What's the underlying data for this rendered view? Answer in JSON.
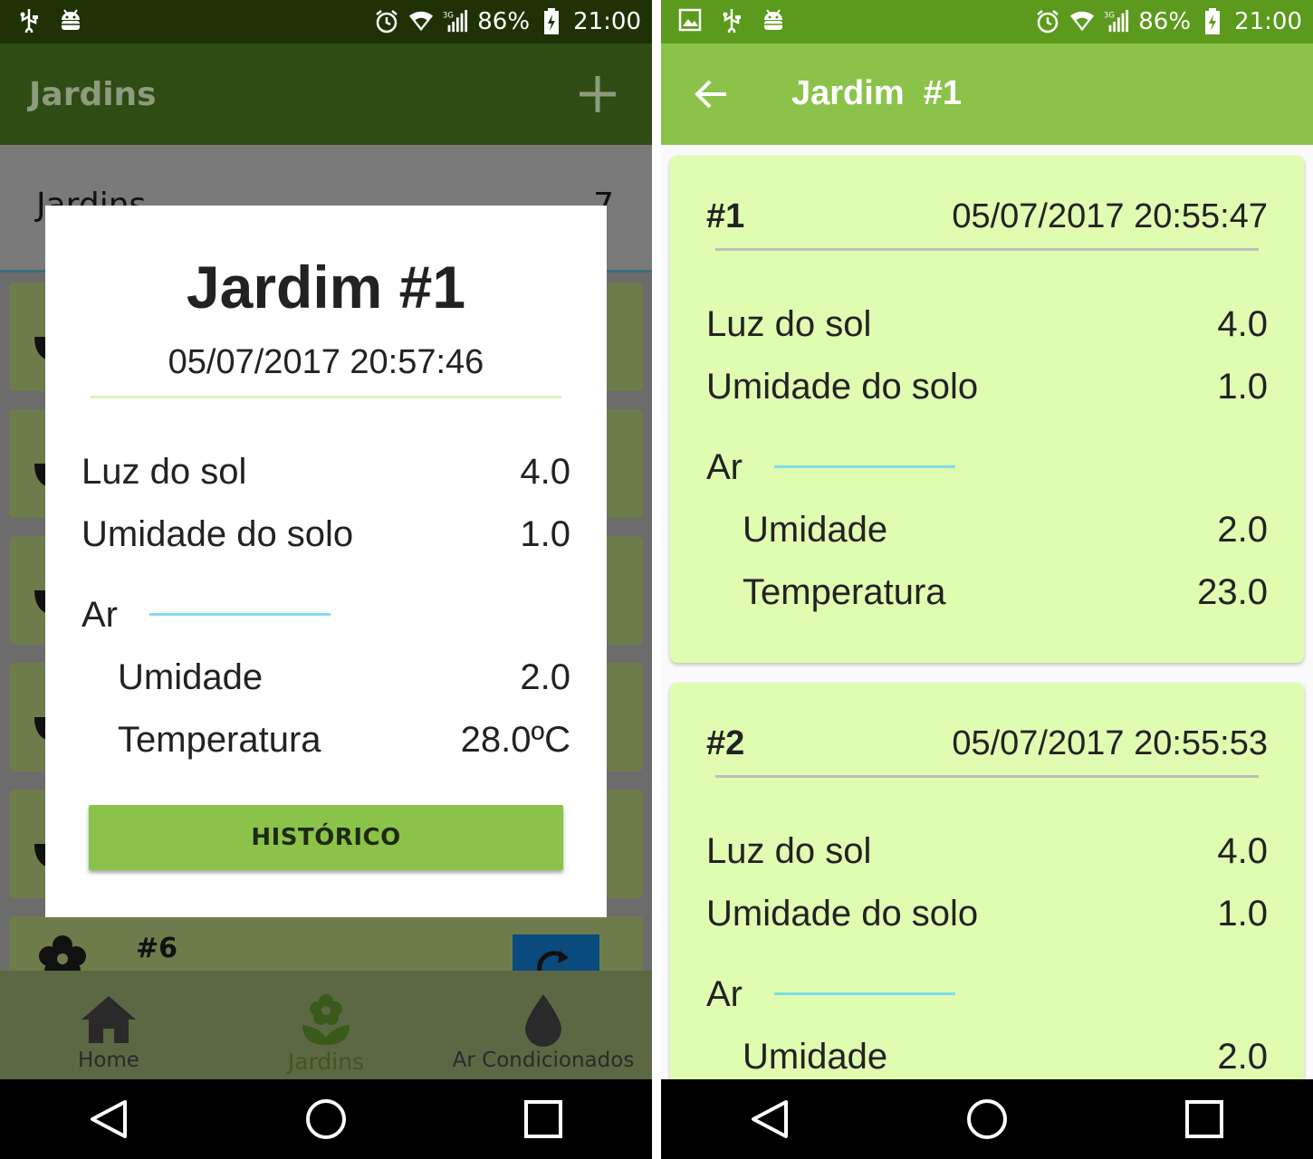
{
  "status_bar": {
    "battery": "86%",
    "time": "21:00",
    "network": "3G"
  },
  "left": {
    "app_title": "Jardins",
    "list_header": {
      "label": "Jardins",
      "count": "7"
    },
    "partial_item_number": "#6",
    "dialog": {
      "title": "Jardim #1",
      "date": "05/07/2017 20:57:46",
      "rows": [
        {
          "label": "Luz do sol",
          "value": "4.0"
        },
        {
          "label": "Umidade do solo",
          "value": "1.0"
        }
      ],
      "ar_label": "Ar",
      "ar_rows": [
        {
          "label": "Umidade",
          "value": "2.0"
        },
        {
          "label": "Temperatura",
          "value": "28.0ºC"
        }
      ],
      "button": "HISTÓRICO"
    },
    "bottom_nav": [
      {
        "label": "Home",
        "icon": "home-icon"
      },
      {
        "label": "Jardins",
        "icon": "flower-icon"
      },
      {
        "label": "Ar Condicionados",
        "icon": "drop-icon"
      }
    ]
  },
  "right": {
    "app_title": "Jardim  #1",
    "cards": [
      {
        "number": "#1",
        "date": "05/07/2017 20:55:47",
        "rows": [
          {
            "label": "Luz do sol",
            "value": "4.0"
          },
          {
            "label": "Umidade do solo",
            "value": "1.0"
          }
        ],
        "ar_label": "Ar",
        "ar_rows": [
          {
            "label": "Umidade",
            "value": "2.0"
          },
          {
            "label": "Temperatura",
            "value": "23.0"
          }
        ]
      },
      {
        "number": "#2",
        "date": "05/07/2017 20:55:53",
        "rows": [
          {
            "label": "Luz do sol",
            "value": "4.0"
          },
          {
            "label": "Umidade do solo",
            "value": "1.0"
          }
        ],
        "ar_label": "Ar",
        "ar_rows": [
          {
            "label": "Umidade",
            "value": "2.0"
          }
        ]
      }
    ]
  },
  "colors": {
    "primary": "#8bc34a",
    "primary_dark": "#5b9a1c",
    "card_bg": "#dffcb0",
    "ar_line": "#80deea"
  }
}
